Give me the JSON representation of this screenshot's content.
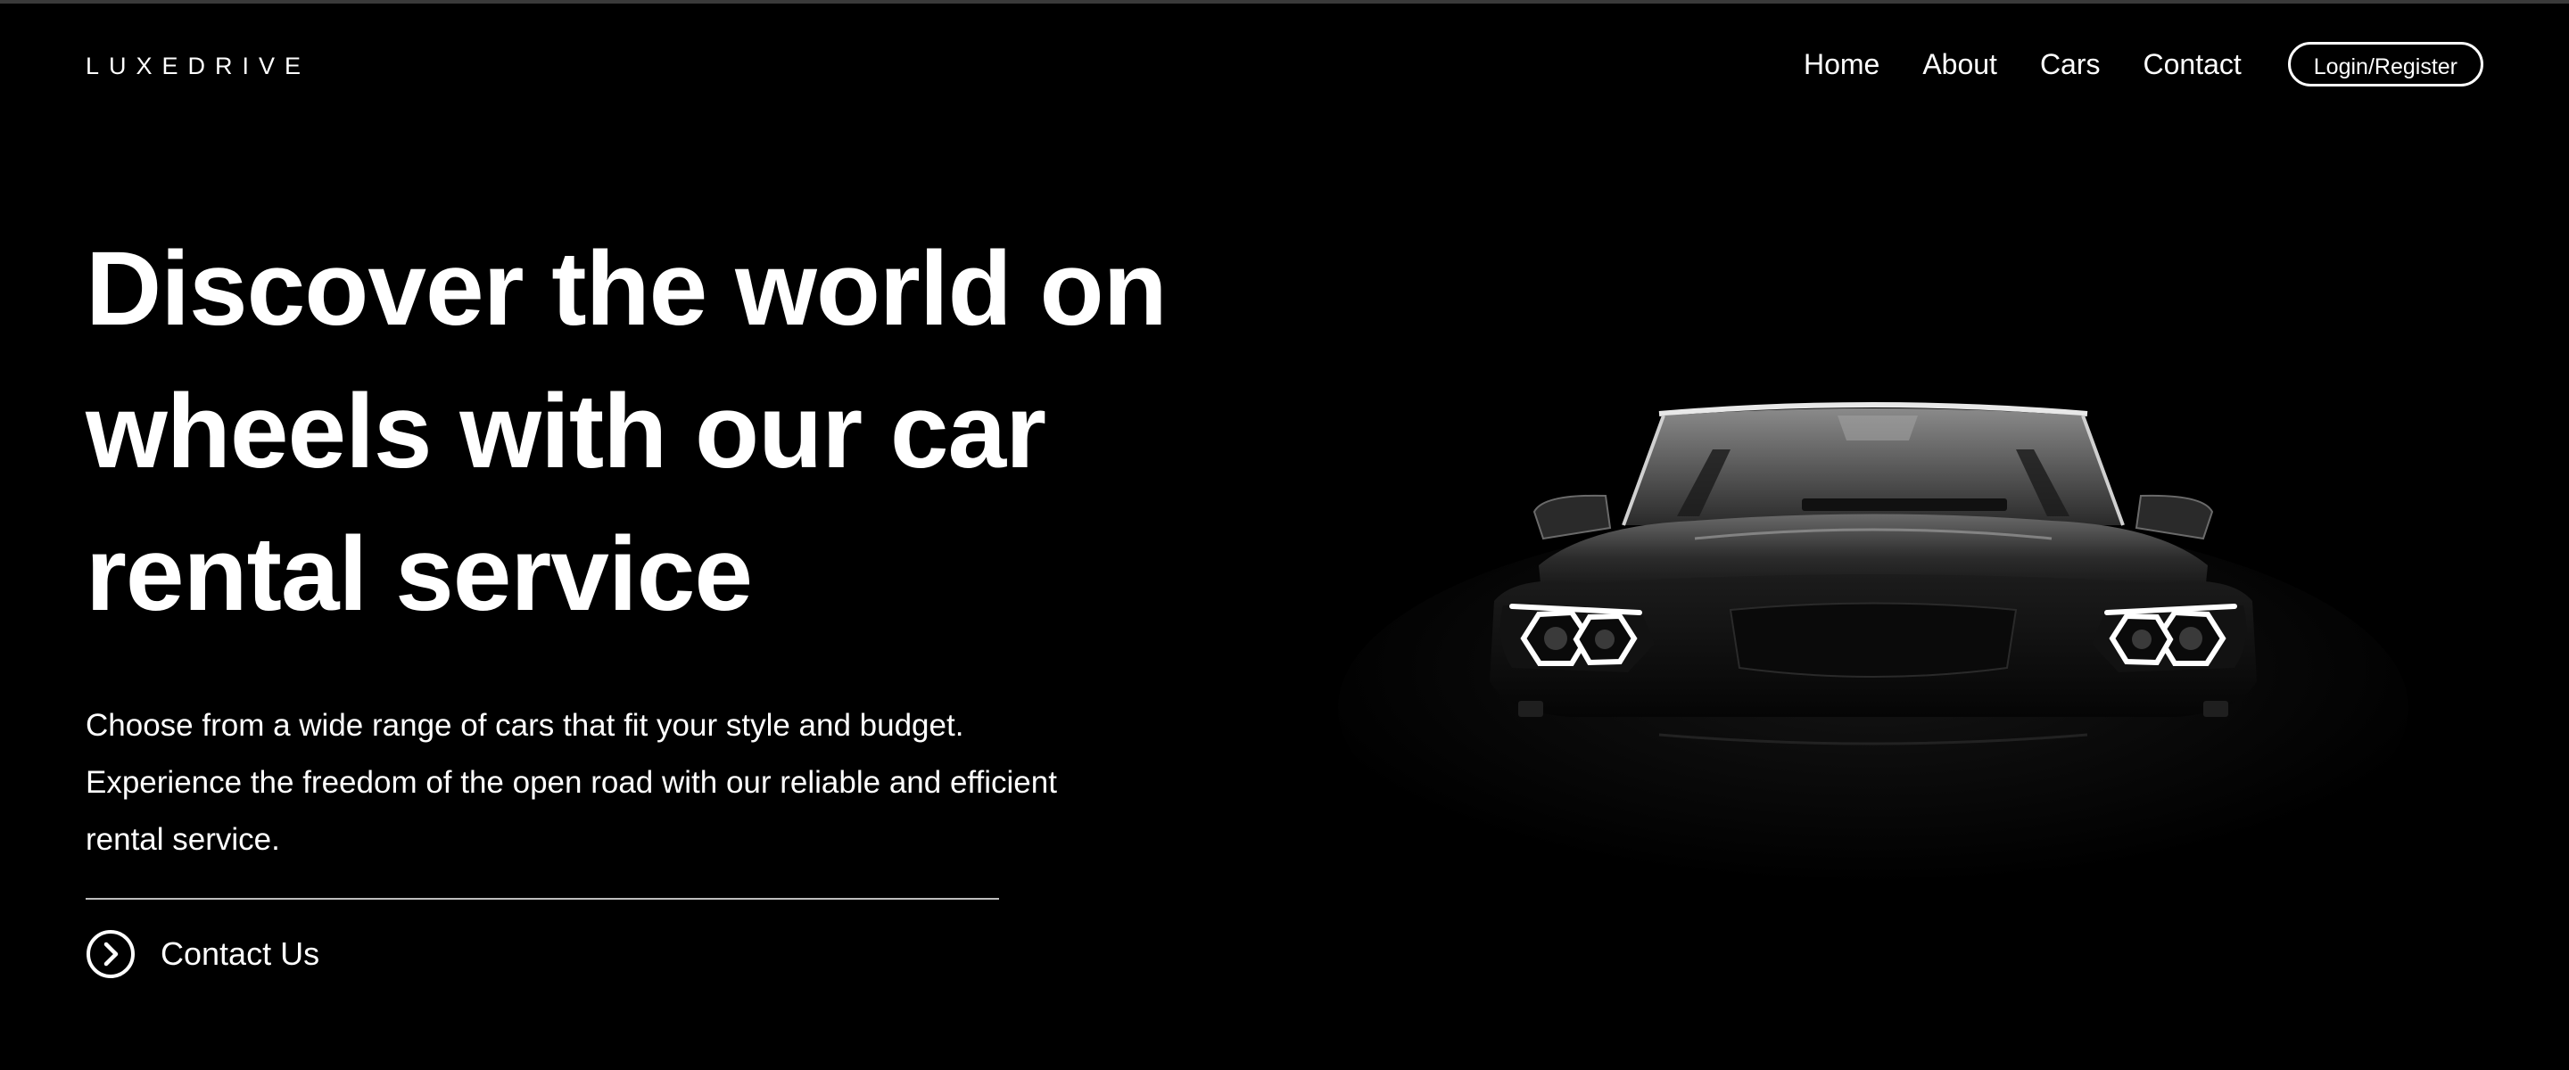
{
  "header": {
    "logo": "LUXEDRIVE",
    "nav": [
      "Home",
      "About",
      "Cars",
      "Contact"
    ],
    "login_label": "Login/Register"
  },
  "hero": {
    "headline": "Discover the world on wheels with our car rental service",
    "description": "Choose from a wide range of cars that fit your style and budget. Experience the freedom of the open road with our reliable and efficient rental service.",
    "cta_label": "Contact Us"
  },
  "colors": {
    "background": "#000000",
    "text": "#ffffff"
  },
  "icons": {
    "cta": "chevron-right-circle-icon"
  }
}
